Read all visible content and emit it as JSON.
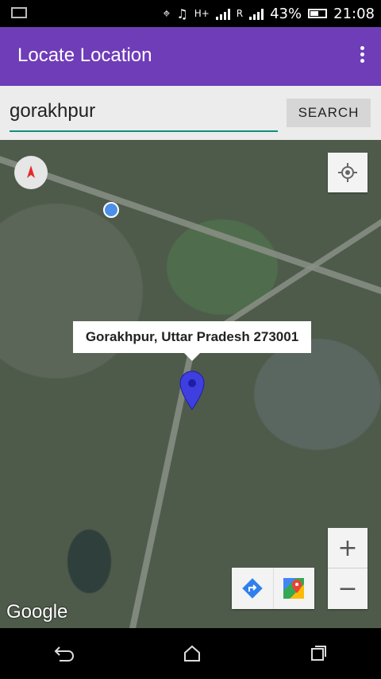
{
  "status_bar": {
    "battery": "43%",
    "time": "21:08",
    "signal_labels": [
      "H+",
      "R"
    ]
  },
  "app": {
    "title": "Locate Location"
  },
  "search": {
    "value": "gorakhpur",
    "button": "SEARCH"
  },
  "map": {
    "callout": "Gorakhpur, Uttar Pradesh 273001",
    "zoom_in": "+",
    "zoom_out": "−",
    "logo": "Google",
    "icons": [
      "compass-icon",
      "my-location-icon",
      "marker-icon",
      "directions-icon",
      "maps-app-icon"
    ]
  },
  "colors": {
    "appbar": "#6f3db8",
    "accent": "#0f8f83",
    "marker": "#3f3fe0"
  }
}
